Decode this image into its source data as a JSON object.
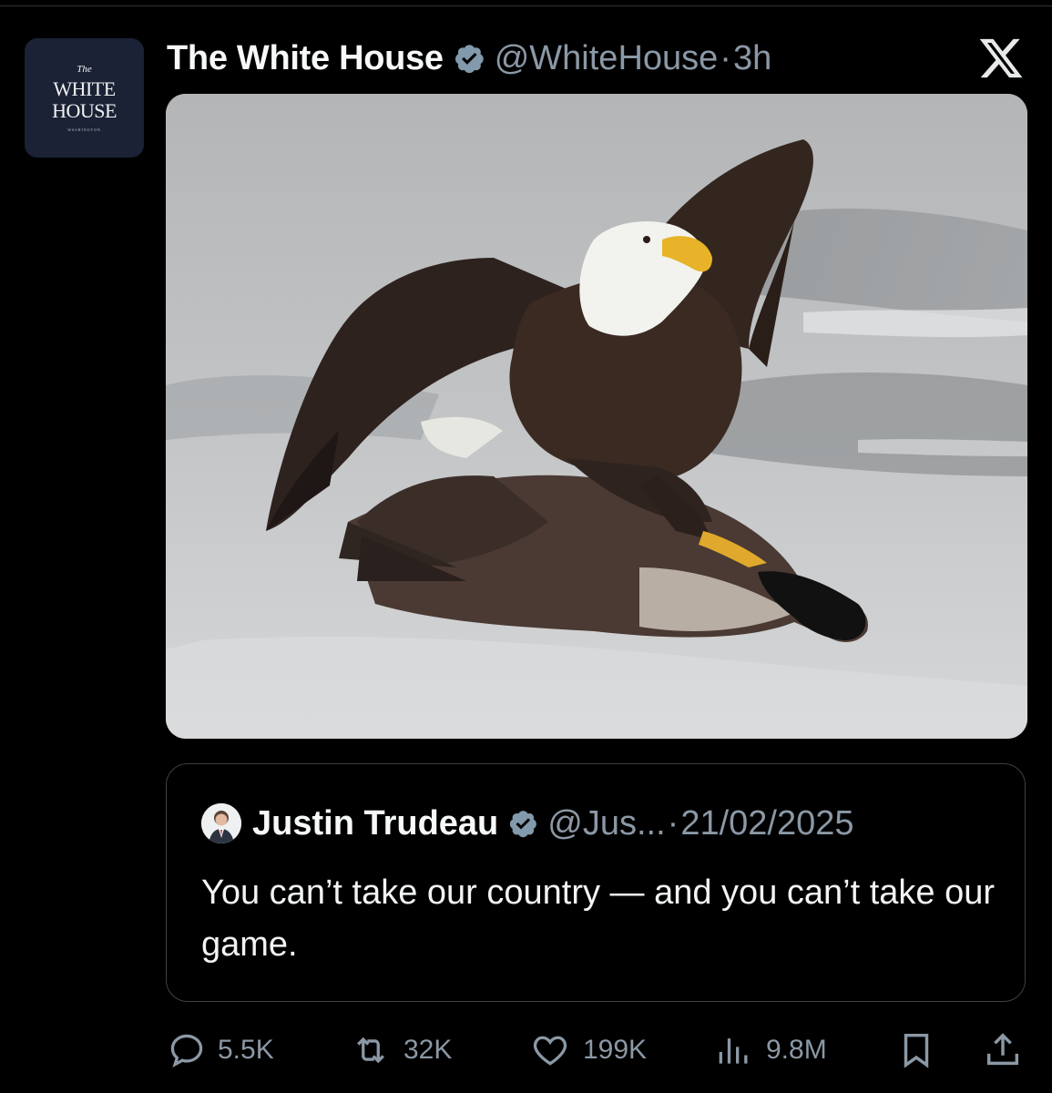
{
  "tweet": {
    "avatar": {
      "the": "The",
      "line1": "WHITE",
      "line2": "HOUSE",
      "small": "WASHINGTON"
    },
    "display_name": "The White House",
    "handle": "@WhiteHouse",
    "separator": "·",
    "time": "3h",
    "media_icon": "eagle-attacking-goose-photo"
  },
  "quoted": {
    "display_name": "Justin Trudeau",
    "handle": "@Jus...",
    "separator": "·",
    "date": "21/02/2025",
    "text": "You can’t take our country — and you can’t take our game."
  },
  "actions": {
    "replies": "5.5K",
    "reposts": "32K",
    "likes": "199K",
    "views": "9.8M"
  },
  "colors": {
    "background": "#000000",
    "secondary_text": "#8b98a5",
    "verified_badge": "#829aab"
  }
}
